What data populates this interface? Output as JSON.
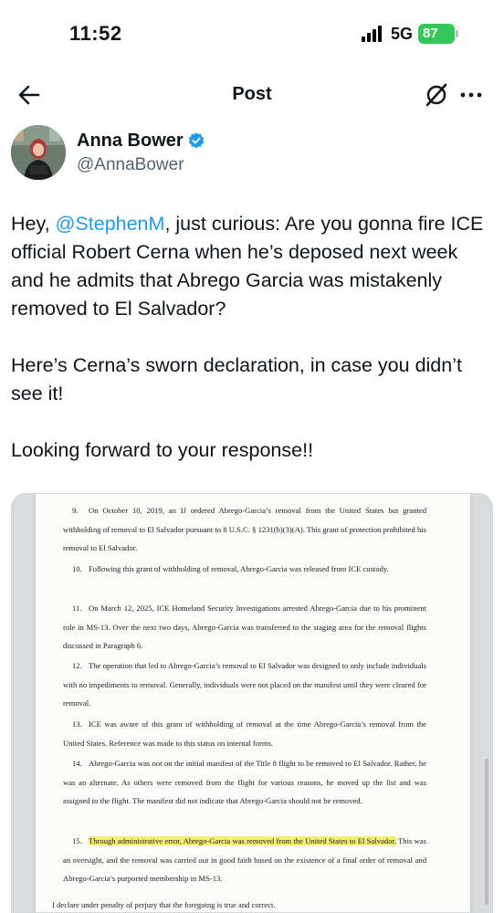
{
  "status": {
    "time": "11:52",
    "network": "5G",
    "battery": "87"
  },
  "header": {
    "title": "Post",
    "back_icon": "arrow-left-icon",
    "grok_icon": "grok-icon",
    "more_icon": "more-icon"
  },
  "author": {
    "name": "Anna Bower",
    "handle": "@AnnaBower",
    "verified_color": "#1d9bf0"
  },
  "tweet": {
    "p1_before": "Hey, ",
    "p1_mention": "@StephenM",
    "p1_after": ", just curious: Are you gonna fire ICE official Robert Cerna when he’s deposed next week and he admits that Abrego Garcia was mistakenly removed to El Salvador?",
    "p2": "Here’s Cerna’s sworn declaration, in case you didn’t see it!",
    "p3": "Looking forward to your response!!"
  },
  "document": {
    "paragraphs": [
      {
        "num": "9.",
        "text": "On October 10, 2019, an IJ ordered Abrego-Garcia’s removal from the United States but granted withholding of removal to El Salvador pursuant to 8 U.S.C. § 1231(b)(3)(A). This grant of protection prohibited his removal to El Salvador."
      },
      {
        "num": "10.",
        "text": "Following this grant of withholding of removal, Abrego-Garcia was released from ICE custody."
      },
      {
        "num": "11.",
        "text": "On March 12, 2025, ICE Homeland Security Investigations arrested Abrego-Garcia due to his prominent role in MS-13. Over the next two days, Abrego-Garcia was transferred to the staging area for the removal flights discussed in Paragraph 6."
      },
      {
        "num": "12.",
        "text": "The operation that led to Abrego-Garcia’s removal to El Salvador was designed to only include individuals with no impediments to removal. Generally, individuals were not placed on the manifest until they were cleared for removal."
      },
      {
        "num": "13.",
        "text": "ICE was aware of this grant of withholding of removal at the time Abrego-Garcia’s removal from the United States. Reference was made to this status on internal forms."
      },
      {
        "num": "14.",
        "text": "Abrego-Garcia was not on the initial manifest of the Title 8 flight to be removed to El Salvador. Rather, he was an alternate. As others were removed from the flight for various reasons, he moved up the list and was assigned to the flight. The manifest did not indicate that Abrego-Garcia should not be removed."
      },
      {
        "num": "15.",
        "highlight": "Through administrative error, Abrego-Garcia was removed from the United States to El Salvador.",
        "text": " This was an oversight, and the removal was carried out in good faith based on the existence of a final order of removal and Abrego-Garcia’s purported membership in MS-13."
      }
    ],
    "closing": "I declare under penalty of perjury that the foregoing is true and correct.",
    "highlight_color": "#f4f06a"
  }
}
